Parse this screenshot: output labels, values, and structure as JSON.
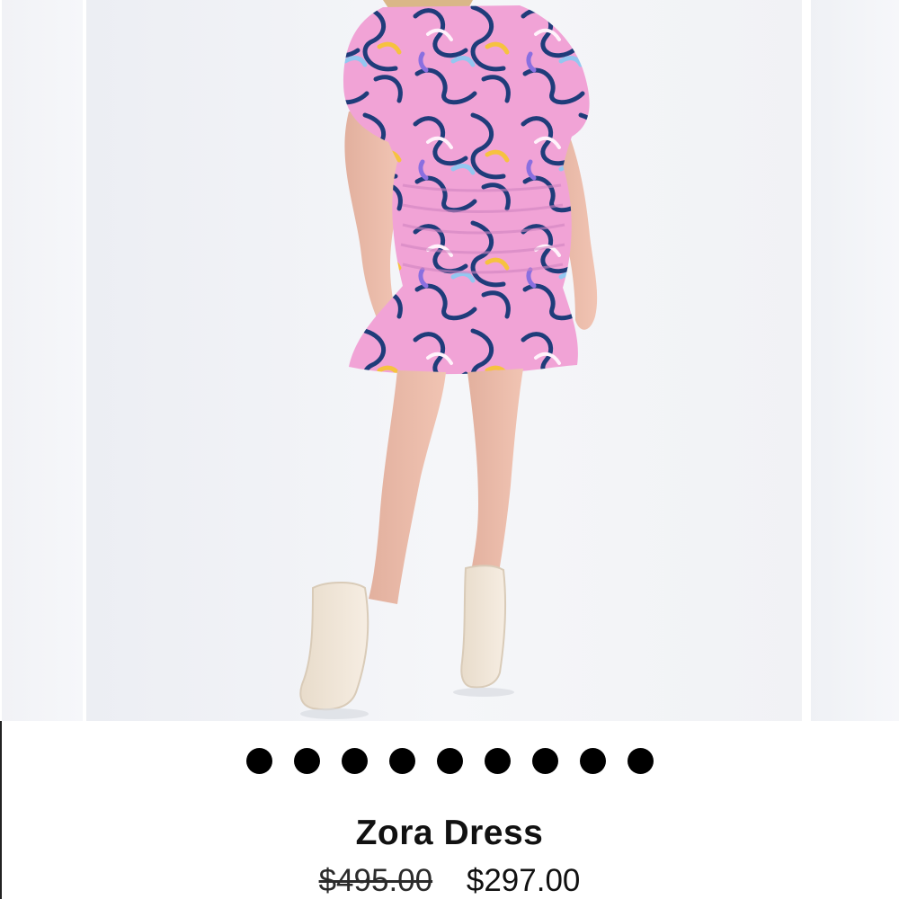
{
  "product": {
    "name": "Zora Dress",
    "price_original": "$495.00",
    "price_sale": "$297.00"
  },
  "carousel": {
    "slide_count": 9,
    "image_description_icon": "product-photo"
  },
  "colors": {
    "dress_pink": "#f1a3d6",
    "dress_navy": "#1f3c7a",
    "boots_cream": "#f2e7d8",
    "dot": "#000000"
  }
}
